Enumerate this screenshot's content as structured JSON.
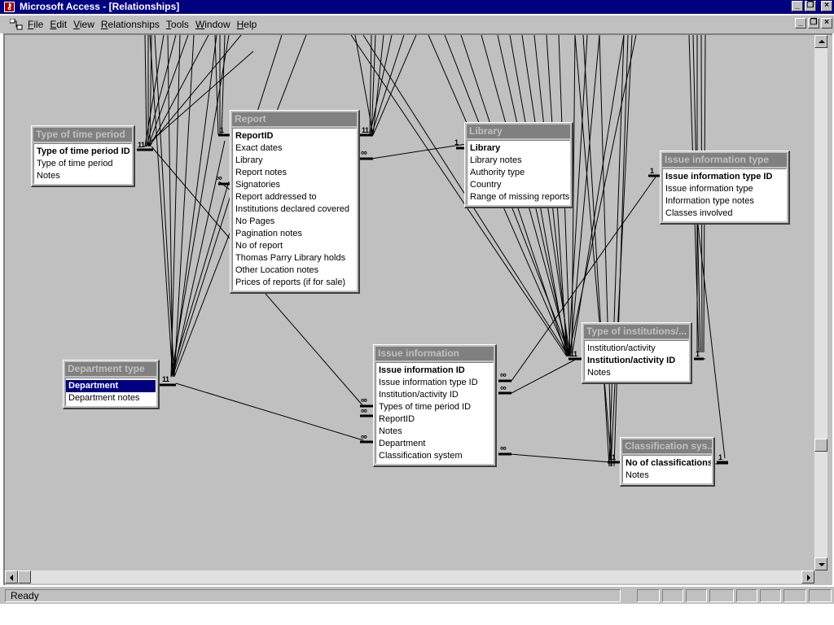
{
  "window": {
    "title": "Microsoft Access - [Relationships]",
    "icon": "access-key-icon"
  },
  "menu": {
    "items": [
      {
        "label": "File",
        "accel": "F"
      },
      {
        "label": "Edit",
        "accel": "E"
      },
      {
        "label": "View",
        "accel": "V"
      },
      {
        "label": "Relationships",
        "accel": "R"
      },
      {
        "label": "Tools",
        "accel": "T"
      },
      {
        "label": "Window",
        "accel": "W"
      },
      {
        "label": "Help",
        "accel": "H"
      }
    ]
  },
  "tables": {
    "type_of_time_period": {
      "title": "Type of time period",
      "fields": [
        {
          "name": "Type of time period ID",
          "key": true
        },
        {
          "name": "Type of time period",
          "key": false
        },
        {
          "name": "Notes",
          "key": false
        }
      ]
    },
    "report": {
      "title": "Report",
      "fields": [
        {
          "name": "ReportID",
          "key": true
        },
        {
          "name": "Exact dates",
          "key": false
        },
        {
          "name": "Library",
          "key": false
        },
        {
          "name": "Report notes",
          "key": false
        },
        {
          "name": "Signatories",
          "key": false
        },
        {
          "name": "Report addressed to",
          "key": false
        },
        {
          "name": "Institutions declared covered",
          "key": false
        },
        {
          "name": "No Pages",
          "key": false
        },
        {
          "name": "Pagination notes",
          "key": false
        },
        {
          "name": "No of report",
          "key": false
        },
        {
          "name": "Thomas Parry Library holds",
          "key": false
        },
        {
          "name": "Other Location notes",
          "key": false
        },
        {
          "name": "Prices of reports (if for sale)",
          "key": false
        }
      ]
    },
    "library": {
      "title": "Library",
      "fields": [
        {
          "name": "Library",
          "key": true
        },
        {
          "name": "Library notes",
          "key": false
        },
        {
          "name": "Authority type",
          "key": false
        },
        {
          "name": "Country",
          "key": false
        },
        {
          "name": "Range of missing reports",
          "key": false
        }
      ]
    },
    "issue_information_type": {
      "title": "Issue information type",
      "fields": [
        {
          "name": "Issue information type ID",
          "key": true
        },
        {
          "name": "Issue information type",
          "key": false
        },
        {
          "name": "Information type notes",
          "key": false
        },
        {
          "name": "Classes involved",
          "key": false
        }
      ]
    },
    "department_type": {
      "title": "Department type",
      "fields": [
        {
          "name": "Department",
          "key": true,
          "selected": true
        },
        {
          "name": "Department notes",
          "key": false
        }
      ]
    },
    "issue_information": {
      "title": "Issue information",
      "fields": [
        {
          "name": "Issue information ID",
          "key": true
        },
        {
          "name": "Issue information type ID",
          "key": false
        },
        {
          "name": "Institution/activity ID",
          "key": false
        },
        {
          "name": "Types of time period ID",
          "key": false
        },
        {
          "name": "ReportID",
          "key": false
        },
        {
          "name": "Notes",
          "key": false
        },
        {
          "name": "Department",
          "key": false
        },
        {
          "name": "Classification system",
          "key": false
        }
      ]
    },
    "type_of_institutions": {
      "title": "Type of institutions/...",
      "fields": [
        {
          "name": "Institution/activity",
          "key": false
        },
        {
          "name": "Institution/activity ID",
          "key": true
        },
        {
          "name": "Notes",
          "key": false
        }
      ]
    },
    "classification_sys": {
      "title": "Classification sys...",
      "fields": [
        {
          "name": "No of classifications",
          "key": true
        },
        {
          "name": "Notes",
          "key": false
        }
      ]
    }
  },
  "markers": {
    "one": "1",
    "many": "∞"
  },
  "status": {
    "text": "Ready"
  }
}
